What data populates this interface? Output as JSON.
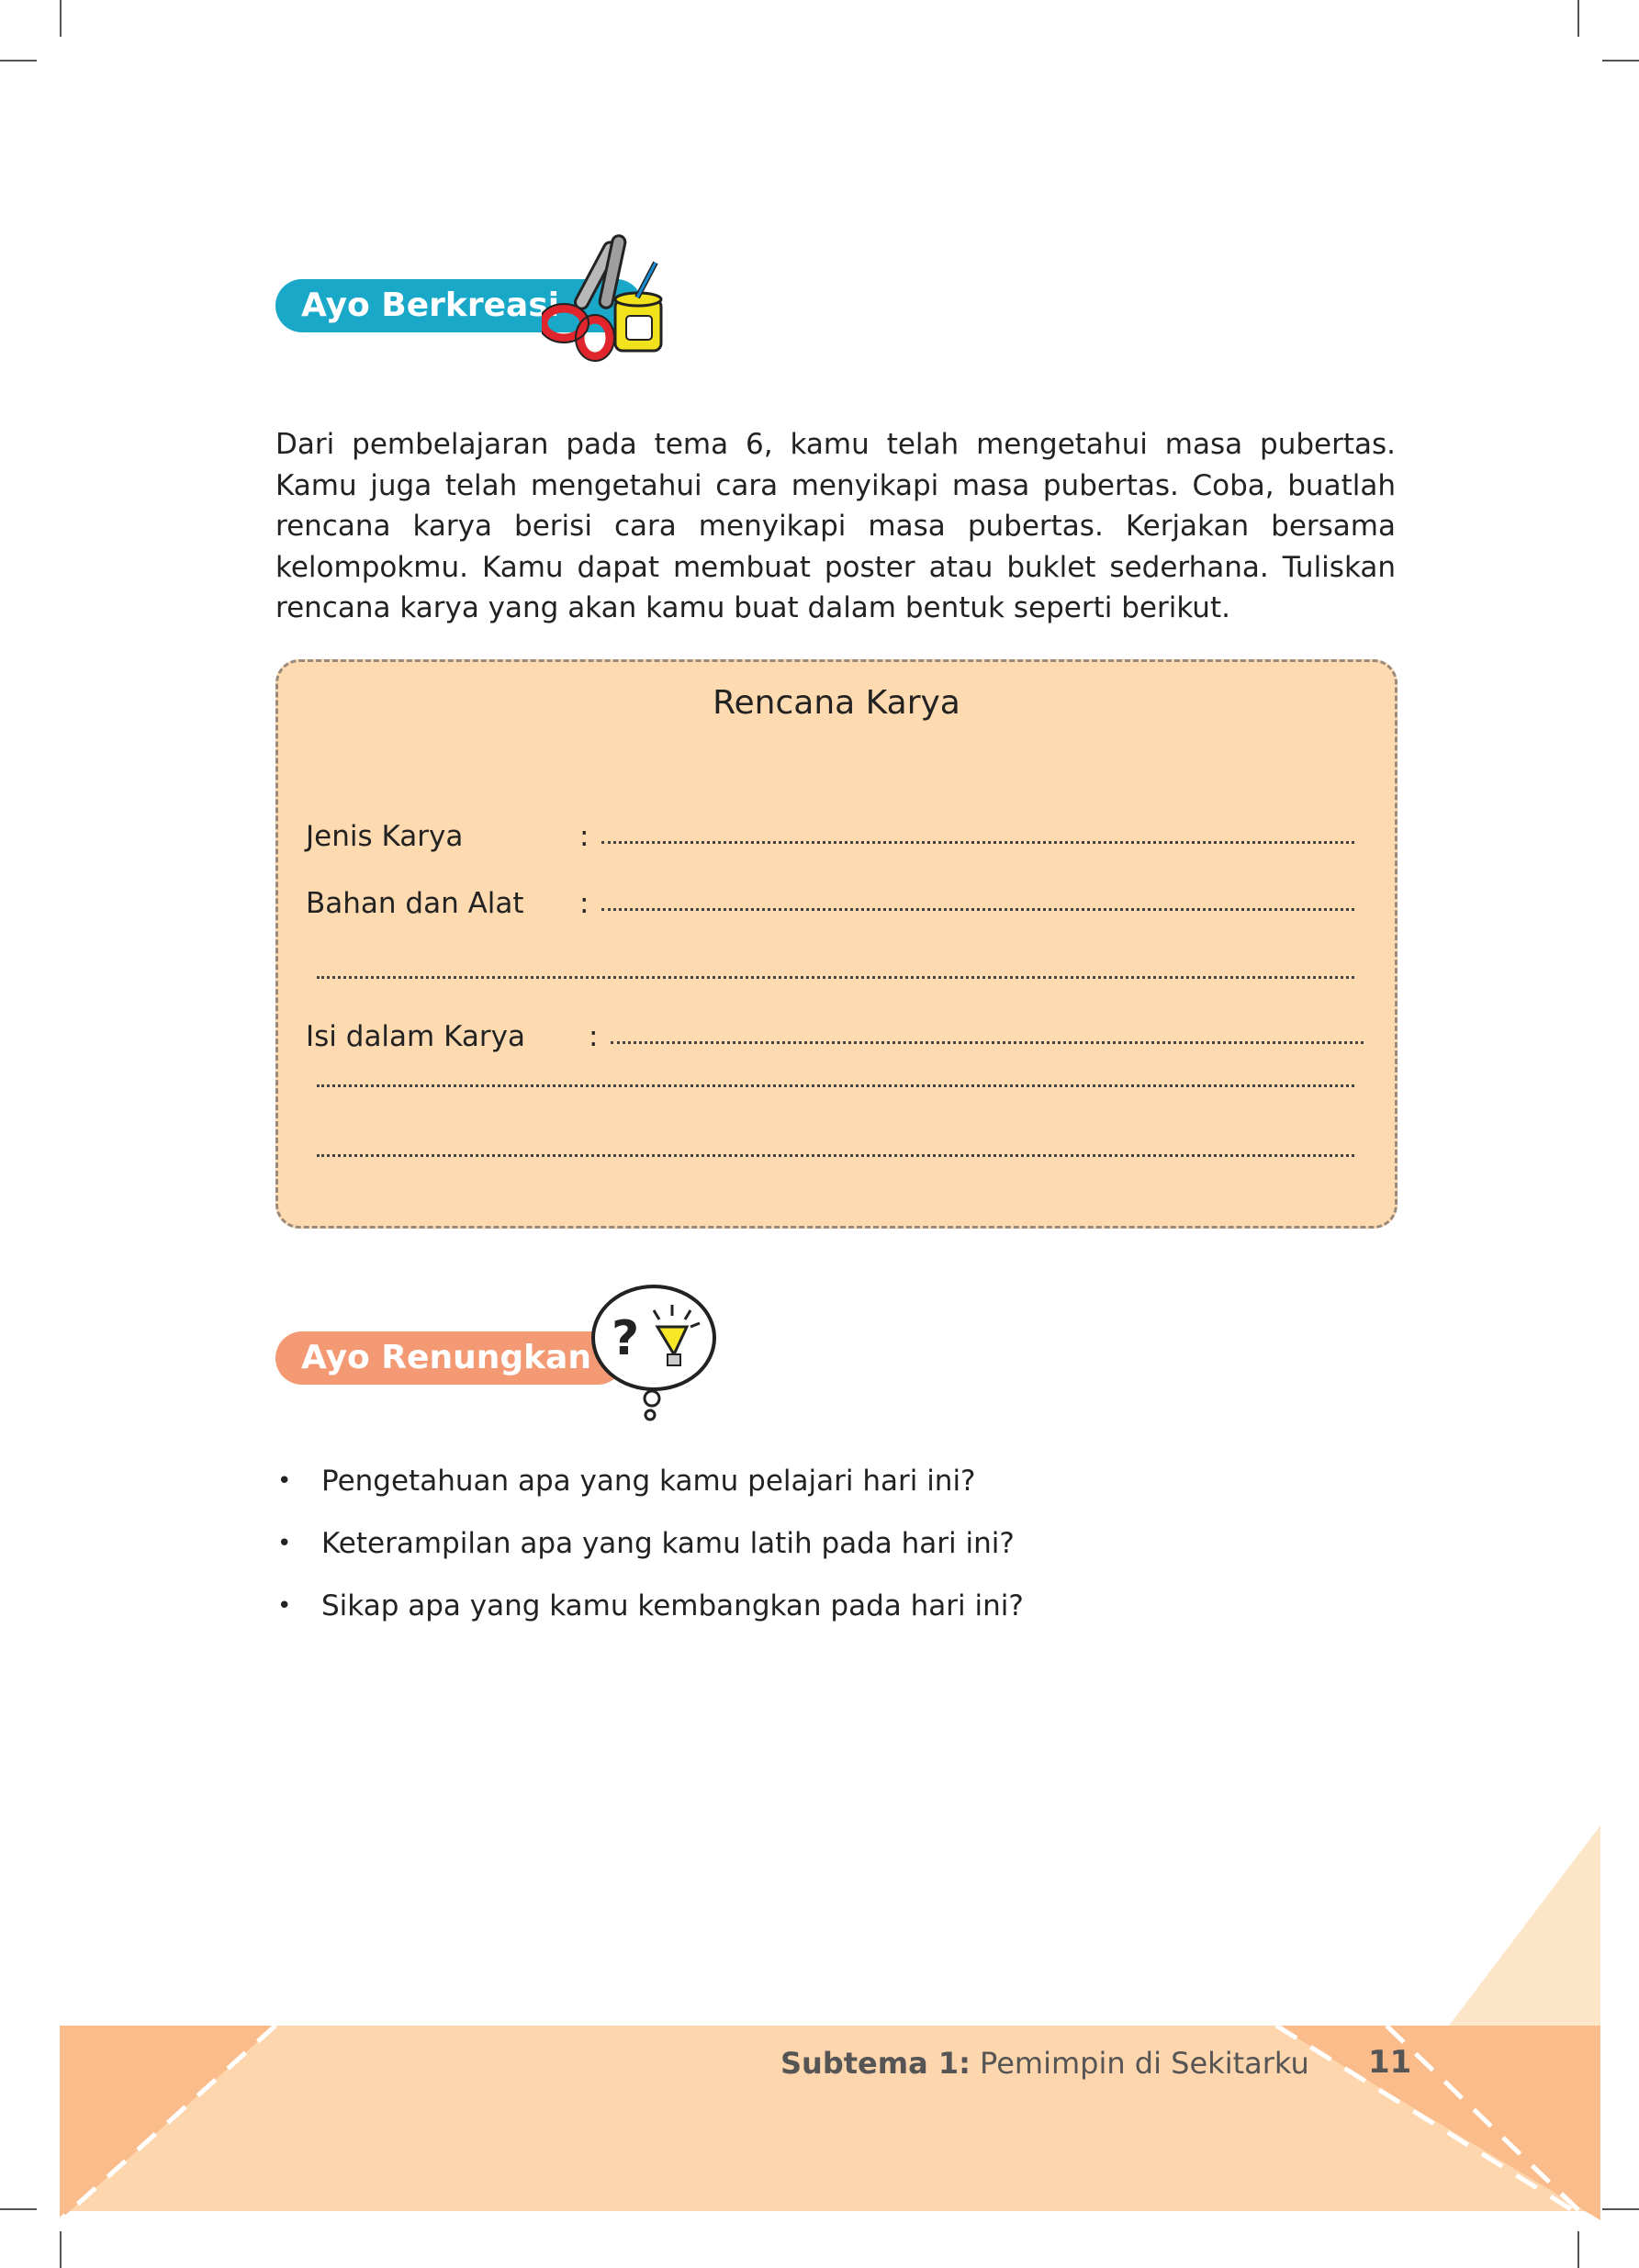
{
  "section_create": {
    "title": "Ayo Berkreasi",
    "icon": "scissors-and-glue-icon"
  },
  "intro_paragraph": "Dari pembelajaran pada tema 6, kamu telah mengetahui masa pubertas. Kamu juga telah mengetahui cara menyikapi masa pubertas. Coba, buatlah rencana karya berisi cara menyikapi masa pubertas. Kerjakan bersama kelompokmu. Kamu dapat membuat poster atau buklet sederhana. Tuliskan rencana karya yang akan kamu buat dalam bentuk seperti berikut.",
  "plan_box": {
    "title": "Rencana Karya",
    "fields": [
      {
        "label": "Jenis Karya",
        "colon": ":"
      },
      {
        "label": "Bahan dan Alat",
        "colon": ":"
      },
      {
        "label": "Isi dalam Karya",
        "colon": ":"
      }
    ]
  },
  "section_reflect": {
    "title": "Ayo Renungkan",
    "icon": "thought-bubble-lightbulb-icon"
  },
  "questions": [
    "Pengetahuan apa yang kamu pelajari hari ini?",
    "Keterampilan apa yang kamu latih pada hari ini?",
    "Sikap apa yang kamu kembangkan pada hari ini?"
  ],
  "footer": {
    "subtheme_label": "Subtema 1:",
    "subtheme_name": "Pemimpin di Sekitarku",
    "page_number": "11"
  },
  "colors": {
    "create_accent": "#1aa8c9",
    "reflect_accent": "#f39a74",
    "plan_box_bg": "#fedab0",
    "footer_band": "#fed6ad"
  }
}
